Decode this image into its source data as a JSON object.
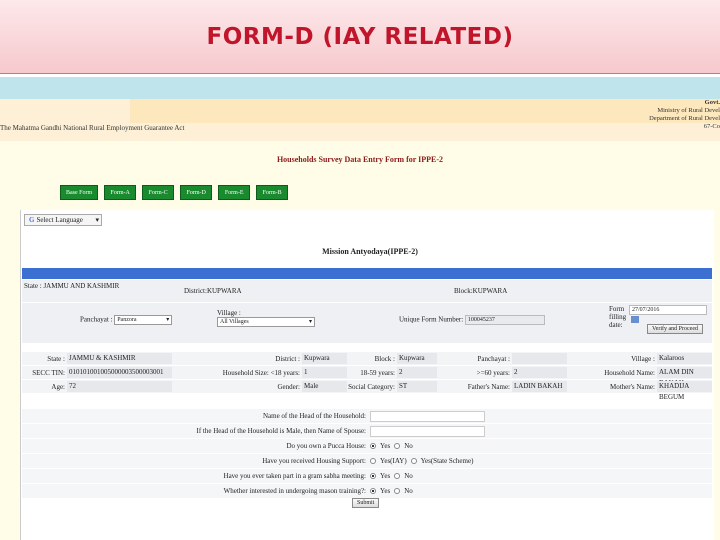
{
  "banner": {
    "title": "FORM-D (IAY RELATED)"
  },
  "header": {
    "left_text": "The Mahatma Gandhi National Rural Employment Guarantee Act",
    "right_lines": [
      "Govt.",
      "Ministry of Rural Devel",
      "Department of Rural Devel",
      "67-Co"
    ]
  },
  "survey_title": "Households Survey Data Entry Form for IPPE-2",
  "nav": [
    "Base Form",
    "Form-A",
    "Form-C",
    "Form-D",
    "Form-E",
    "Form-B"
  ],
  "language": {
    "label": "Select Language",
    "icon": "google-g-icon"
  },
  "mission_title": "Mission Antyodaya(IPPE-2)",
  "location": {
    "state": "State : JAMMU AND KASHMIR",
    "district": "District:KUPWARA",
    "block": "Block:KUPWARA",
    "panchayat_label": "Panchayat :",
    "panchayat_value": "Panzora",
    "village_label": "Village :",
    "village_value": "All Villages",
    "unique_label": "Unique Form Number:",
    "unique_value": "100045237",
    "form_date_label": "Form filling date:",
    "form_date_value": "27/07/2016",
    "verify_button": "Verify and Proceed"
  },
  "household": {
    "row1": [
      {
        "k": "State :",
        "v": "JAMMU & KASHMIR"
      },
      {
        "k": "District :",
        "v": "Kupwara"
      },
      {
        "k": "Block :",
        "v": "Kupwara"
      },
      {
        "k": "Panchayat :",
        "v": ""
      },
      {
        "k": "Village :",
        "v": "Kalaroos"
      }
    ],
    "row2": [
      {
        "k": "SECC TIN:",
        "v": "010101001005000003500003001"
      },
      {
        "k": "Household Size: <18 years:",
        "v": "1"
      },
      {
        "k": "18-59 years:",
        "v": "2"
      },
      {
        "k": ">=60 years:",
        "v": "2"
      },
      {
        "k": "Household Name:",
        "v": "ALAM DIN BAKAH"
      }
    ],
    "row3": [
      {
        "k": "Age:",
        "v": "72"
      },
      {
        "k": "Gender:",
        "v": "Male"
      },
      {
        "k": "Social Category:",
        "v": "ST"
      },
      {
        "k": "Father's Name:",
        "v": "LADIN BAKAH"
      },
      {
        "k": "Mother's Name:",
        "v": "KHADIJA BEGUM"
      }
    ]
  },
  "questions": [
    {
      "label": "Name of the Head of the Household:",
      "type": "text"
    },
    {
      "label": "If the Head of the Household is Male, then Name of Spouse:",
      "type": "text"
    },
    {
      "label": "Do you own a Pucca House:",
      "type": "radio",
      "options": [
        "Yes",
        "No"
      ],
      "selected": 0
    },
    {
      "label": "Have you received Housing Support:",
      "type": "radio",
      "options": [
        "Yes(IAY)",
        "Yes(State Scheme)"
      ],
      "selected": -1
    },
    {
      "label": "Have you ever taken part in a gram sabha meeting:",
      "type": "radio",
      "options": [
        "Yes",
        "No"
      ],
      "selected": 0
    },
    {
      "label": "Whether interested in undergoing mason training?:",
      "type": "radio",
      "options": [
        "Yes",
        "No"
      ],
      "selected": 0
    }
  ],
  "submit_label": "Submit"
}
